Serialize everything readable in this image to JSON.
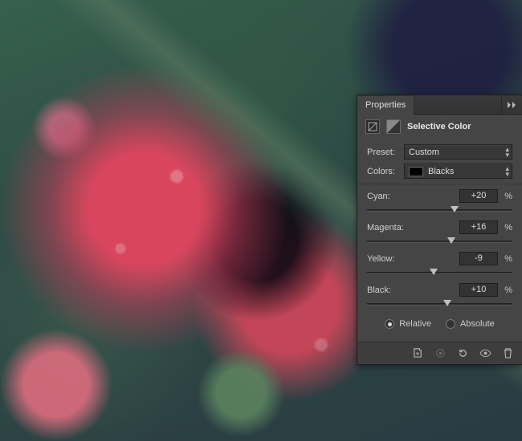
{
  "panel": {
    "tab_label": "Properties",
    "title": "Selective Color",
    "preset_label": "Preset:",
    "preset_value": "Custom",
    "colors_label": "Colors:",
    "colors_value": "Blacks",
    "colors_swatch": "#000000",
    "sliders": [
      {
        "name": "Cyan:",
        "value": "+20",
        "pos": 60
      },
      {
        "name": "Magenta:",
        "value": "+16",
        "pos": 58
      },
      {
        "name": "Yellow:",
        "value": "-9",
        "pos": 46
      },
      {
        "name": "Black:",
        "value": "+10",
        "pos": 55
      }
    ],
    "percent": "%",
    "mode": {
      "relative": "Relative",
      "absolute": "Absolute",
      "selected": "relative"
    }
  }
}
